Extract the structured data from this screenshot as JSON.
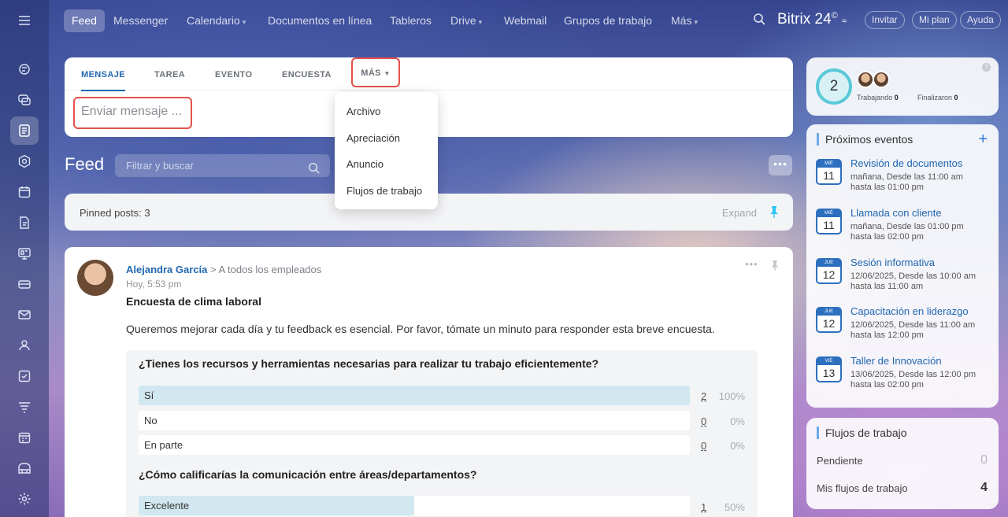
{
  "topnav": {
    "items": [
      {
        "label": "Feed",
        "chevron": false
      },
      {
        "label": "Messenger",
        "chevron": false
      },
      {
        "label": "Calendario",
        "chevron": true
      },
      {
        "label": "Documentos en línea",
        "chevron": false
      },
      {
        "label": "Tableros",
        "chevron": false
      },
      {
        "label": "Drive",
        "chevron": true
      },
      {
        "label": "Webmail",
        "chevron": false
      },
      {
        "label": "Grupos de trabajo",
        "chevron": false
      },
      {
        "label": "Más",
        "chevron": true
      }
    ],
    "brand": "Bitrix 24",
    "brand_mark": "©",
    "invite": "Invitar",
    "plan": "Mi plan",
    "help": "Ayuda"
  },
  "composer": {
    "tabs": [
      "MENSAJE",
      "TAREA",
      "EVENTO",
      "ENCUESTA"
    ],
    "more_tab": "MÁS",
    "placeholder": "Enviar mensaje ...",
    "dropdown": [
      "Archivo",
      "Apreciación",
      "Anuncio",
      "Flujos de trabajo"
    ]
  },
  "feed": {
    "title": "Feed",
    "search_placeholder": "Filtrar y buscar",
    "pinned_label": "Pinned posts: 3",
    "expand": "Expand"
  },
  "post": {
    "author": "Alejandra García",
    "separator": ">",
    "destination": "A todos los empleados",
    "time": "Hoy, 5:53 pm",
    "title": "Encuesta de clima laboral",
    "body": "Queremos mejorar cada día y tu feedback es esencial. Por favor, tómate un minuto para responder esta breve encuesta.",
    "questions": [
      {
        "text": "¿Tienes los recursos y herramientas necesarias para realizar tu trabajo eficientemente?",
        "options": [
          {
            "label": "Sí",
            "count": "2",
            "pct": "100%",
            "fill": 1.0
          },
          {
            "label": "No",
            "count": "0",
            "pct": "0%",
            "fill": 0
          },
          {
            "label": "En parte",
            "count": "0",
            "pct": "0%",
            "fill": 0
          }
        ]
      },
      {
        "text": "¿Cómo calificarías la comunicación entre áreas/departamentos?",
        "options": [
          {
            "label": "Excelente",
            "count": "1",
            "pct": "50%",
            "fill": 0.5
          }
        ]
      }
    ]
  },
  "worktime": {
    "count": "2",
    "working_label": "Trabajando",
    "working_value": "0",
    "finished_label": "Finalizaron",
    "finished_value": "0",
    "help": "?"
  },
  "events": {
    "title": "Próximos eventos",
    "add": "+",
    "items": [
      {
        "dow": "MIÉ",
        "day": "11",
        "title": "Revisión de documentos",
        "line1": "mañana, Desde las 11:00 am",
        "line2": "hasta las 01:00 pm"
      },
      {
        "dow": "MIÉ",
        "day": "11",
        "title": "Llamada con cliente",
        "line1": "mañana, Desde las 01:00 pm",
        "line2": "hasta las 02:00 pm"
      },
      {
        "dow": "JUE",
        "day": "12",
        "title": "Sesión informativa",
        "line1": "12/06/2025, Desde las 10:00 am",
        "line2": "hasta las 11:00 am"
      },
      {
        "dow": "JUE",
        "day": "12",
        "title": "Capacitación en liderazgo",
        "line1": "12/06/2025, Desde las 11:00 am",
        "line2": "hasta las 12:00 pm"
      },
      {
        "dow": "VIE",
        "day": "13",
        "title": "Taller de Innovación",
        "line1": "13/06/2025, Desde las 12:00 pm",
        "line2": "hasta las 02:00 pm"
      }
    ]
  },
  "workflows": {
    "title": "Flujos de trabajo",
    "pending_label": "Pendiente",
    "pending_value": "0",
    "mine_label": "Mis flujos de trabajo",
    "mine_value": "4"
  },
  "colors": {
    "accent": "#2067b0",
    "highlight": "#e45149",
    "poll_fill": "#d1e8f1"
  }
}
